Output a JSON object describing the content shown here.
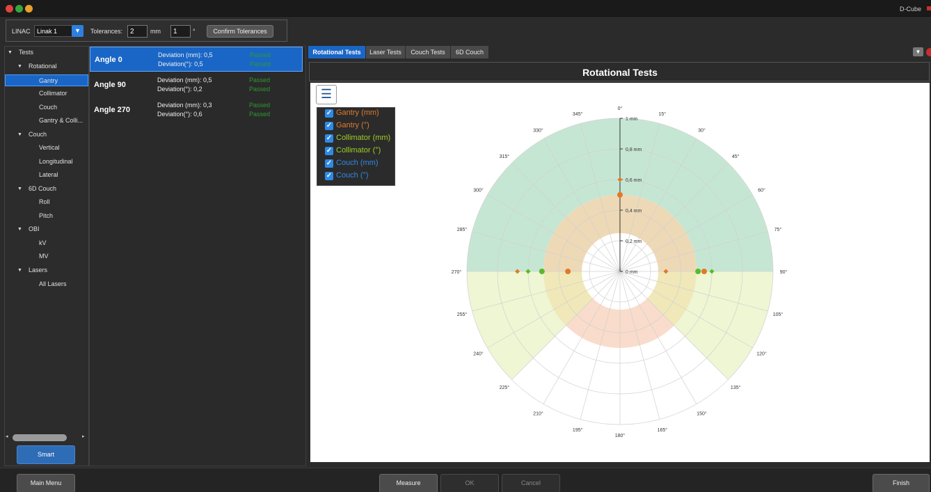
{
  "window": {
    "app_title": "D-Cube"
  },
  "toolbar": {
    "linac_label": "LINAC",
    "linac_value": "Linak 1",
    "tolerances_label": "Tolerances:",
    "tol_mm_value": "2",
    "tol_mm_unit": "mm",
    "tol_deg_value": "1",
    "tol_deg_unit": "°",
    "confirm_label": "Confirm Tolerances"
  },
  "tree": {
    "items": [
      {
        "label": "Tests"
      },
      {
        "label": "Rotational"
      },
      {
        "label": "Gantry"
      },
      {
        "label": "Collimator"
      },
      {
        "label": "Couch"
      },
      {
        "label": "Gantry & Colli..."
      },
      {
        "label": "Couch"
      },
      {
        "label": "Vertical"
      },
      {
        "label": "Longitudinal"
      },
      {
        "label": "Lateral"
      },
      {
        "label": "6D Couch"
      },
      {
        "label": "Roll"
      },
      {
        "label": "Pitch"
      },
      {
        "label": "OBI"
      },
      {
        "label": "kV"
      },
      {
        "label": "MV"
      },
      {
        "label": "Lasers"
      },
      {
        "label": "All Lasers"
      }
    ],
    "smart_label": "Smart"
  },
  "results": [
    {
      "angle": "Angle 0",
      "dev_mm": "Deviation (mm): 0,5",
      "dev_deg": "Deviation(°): 0,5",
      "status_mm": "Passed",
      "status_deg": "Passed"
    },
    {
      "angle": "Angle 90",
      "dev_mm": "Deviation (mm): 0,5",
      "dev_deg": "Deviation(°): 0,2",
      "status_mm": "Passed",
      "status_deg": "Passed"
    },
    {
      "angle": "Angle 270",
      "dev_mm": "Deviation (mm): 0,3",
      "dev_deg": "Deviation(°): 0,6",
      "status_mm": "Passed",
      "status_deg": "Passed"
    }
  ],
  "tabs": [
    {
      "label": "Rotational Tests",
      "active": true
    },
    {
      "label": "Laser Tests"
    },
    {
      "label": "Couch Tests"
    },
    {
      "label": "6D Couch"
    }
  ],
  "panel": {
    "title": "Rotational Tests",
    "menu_icon": "hamburger-menu-icon"
  },
  "legend": [
    {
      "label": "Gantry (mm)",
      "color": "#e07a2a",
      "checked": true
    },
    {
      "label": "Gantry (°)",
      "color": "#e07a2a",
      "checked": true
    },
    {
      "label": "Collimator (mm)",
      "color": "#9fcf25",
      "checked": true
    },
    {
      "label": "Collimator (°)",
      "color": "#9fcf25",
      "checked": true
    },
    {
      "label": "Couch (mm)",
      "color": "#2d8ae6",
      "checked": true
    },
    {
      "label": "Couch (°)",
      "color": "#2d8ae6",
      "checked": true
    }
  ],
  "chart_data": {
    "type": "polar",
    "angle_ticks": [
      "0°",
      "15°",
      "30°",
      "45°",
      "60°",
      "75°",
      "90°",
      "105°",
      "120°",
      "135°",
      "150°",
      "165°",
      "180°",
      "195°",
      "210°",
      "225°",
      "240°",
      "255°",
      "270°",
      "285°",
      "300°",
      "315°",
      "330°",
      "345°"
    ],
    "radial_ticks": [
      "0 mm",
      "0,2 mm",
      "0,4 mm",
      "0,6 mm",
      "0,8 mm",
      "1 mm"
    ],
    "r_max": 1,
    "bands": [
      {
        "name": "Gantry band",
        "angle_from": -90,
        "angle_to": 90,
        "r_from": 0.5,
        "r_to": 1.0,
        "color": "#c6e6d4"
      },
      {
        "name": "Gantry tolerance",
        "angle_from": -90,
        "angle_to": 90,
        "r_from": 0.25,
        "r_to": 0.5,
        "color": "#eed9b6"
      },
      {
        "name": "Collimator band",
        "angle_from": 90,
        "angle_to": 135,
        "r_from": 0.5,
        "r_to": 1.0,
        "color": "#eef6d4"
      },
      {
        "name": "Collimator band",
        "angle_from": 225,
        "angle_to": 270,
        "r_from": 0.5,
        "r_to": 1.0,
        "color": "#eef6d4"
      },
      {
        "name": "Collimator tolerance",
        "angle_from": 90,
        "angle_to": 135,
        "r_from": 0.25,
        "r_to": 0.5,
        "color": "#f0e8b9"
      },
      {
        "name": "Collimator tolerance",
        "angle_from": 225,
        "angle_to": 270,
        "r_from": 0.25,
        "r_to": 0.5,
        "color": "#f0e8b9"
      },
      {
        "name": "Couch tolerance",
        "angle_from": 135,
        "angle_to": 225,
        "r_from": 0.25,
        "r_to": 0.5,
        "color": "#f9dccb"
      }
    ],
    "series": [
      {
        "name": "Gantry (mm)",
        "color": "#e07a2a",
        "marker": "circle",
        "points": [
          [
            0,
            0.5
          ],
          [
            90,
            0.55
          ],
          [
            270,
            0.34
          ]
        ]
      },
      {
        "name": "Gantry (°)",
        "color": "#e07a2a",
        "marker": "diamond",
        "points": [
          [
            0,
            0.6
          ],
          [
            90,
            0.3
          ],
          [
            270,
            0.67
          ]
        ]
      },
      {
        "name": "Collimator (mm)",
        "color": "#5bb92a",
        "marker": "circle",
        "points": [
          [
            90,
            0.51
          ],
          [
            270,
            0.51
          ]
        ]
      },
      {
        "name": "Collimator (°)",
        "color": "#5bb92a",
        "marker": "diamond",
        "points": [
          [
            90,
            0.6
          ],
          [
            270,
            0.6
          ]
        ]
      }
    ]
  },
  "bottom": {
    "main_menu": "Main Menu",
    "measure": "Measure",
    "ok": "OK",
    "cancel": "Cancel",
    "finish": "Finish"
  }
}
